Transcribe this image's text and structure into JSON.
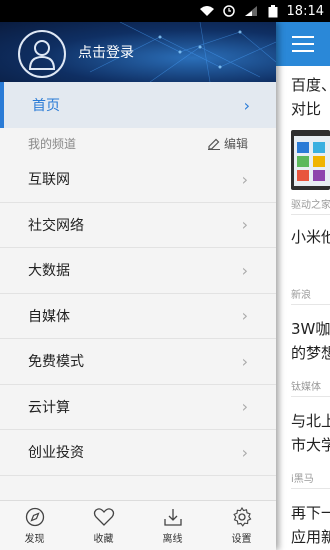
{
  "status_bar": {
    "time": "18:14"
  },
  "drawer": {
    "login_label": "点击登录",
    "home_label": "首页",
    "section_label": "我的频道",
    "edit_label": "编辑",
    "channels": [
      "互联网",
      "社交网络",
      "大数据",
      "自媒体",
      "免费模式",
      "云计算",
      "创业投资"
    ]
  },
  "bottom_tabs": [
    "发现",
    "收藏",
    "离线",
    "设置"
  ],
  "feed": {
    "item1_title_line1": "百度、",
    "item1_title_line2": "对比",
    "item1_source": "驱动之家",
    "item2_title": "小米他",
    "item2_source": "新浪",
    "item3_title_line1": "3W咖",
    "item3_title_line2": "的梦想",
    "item3_source": "钛媒体",
    "item4_title_line1": "与北上",
    "item4_title_line2": "市大学",
    "item4_source": "i黑马",
    "item5_title_line1": "再下一",
    "item5_title_line2": "应用新"
  },
  "colors": {
    "accent": "#2a7bd6",
    "topbar": "#2a88d8"
  }
}
